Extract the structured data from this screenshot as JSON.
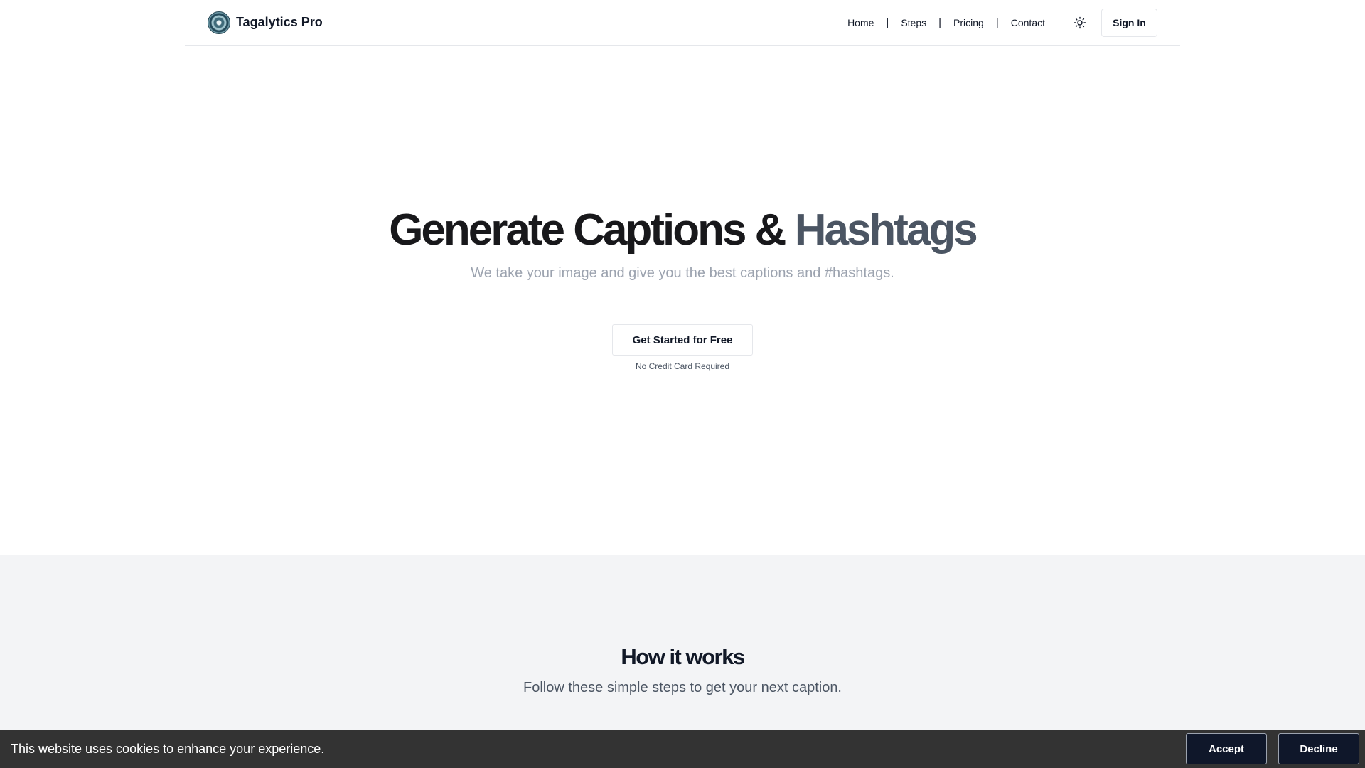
{
  "nav": {
    "brand": "Tagalytics Pro",
    "links": [
      "Home",
      "Steps",
      "Pricing",
      "Contact"
    ],
    "separator": "|",
    "theme_icon": "sun-icon",
    "signin_label": "Sign In"
  },
  "hero": {
    "title_part1": "Generate Captions &",
    "title_part2": "Hashtags",
    "subtitle": "We take your image and give you the best captions and #hashtags.",
    "cta_label": "Get Started for Free",
    "cta_note": "No Credit Card Required"
  },
  "how": {
    "title": "How it works",
    "subtitle": "Follow these simple steps to get your next caption."
  },
  "cookie": {
    "text": "This website uses cookies to enhance your experience.",
    "accept_label": "Accept",
    "decline_label": "Decline"
  },
  "colors": {
    "cookie_bar": "#333333",
    "cookie_button": "#0f172a",
    "section_bg": "#f3f4f6"
  }
}
